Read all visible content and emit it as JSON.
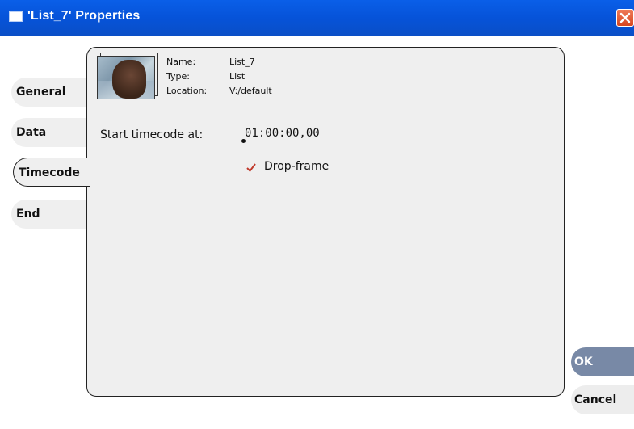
{
  "window": {
    "title": "'List_7' Properties"
  },
  "tabs": [
    {
      "label": "General"
    },
    {
      "label": "Data"
    },
    {
      "label": "Timecode"
    },
    {
      "label": "End"
    }
  ],
  "active_tab": "Timecode",
  "info": {
    "name_label": "Name:",
    "name_value": "List_7",
    "type_label": "Type:",
    "type_value": "List",
    "location_label": "Location:",
    "location_value": "V:/default"
  },
  "timecode": {
    "start_label": "Start timecode at:",
    "start_value": "01:00:00,00",
    "drop_frame_label": "Drop-frame",
    "drop_frame_checked": true
  },
  "buttons": {
    "ok_label": "OK",
    "cancel_label": "Cancel"
  },
  "colors": {
    "titlebar": "#0653d9",
    "close_button": "#d8461f",
    "ok_button": "#7889a6",
    "check_mark": "#c0392b"
  },
  "icons": {
    "window": "window-icon",
    "close": "close-icon",
    "check": "check-icon",
    "thumbnail": "clip-thumbnail"
  }
}
